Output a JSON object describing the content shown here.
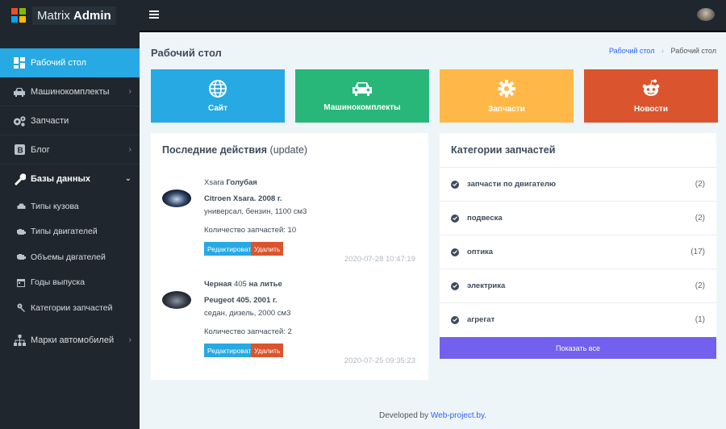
{
  "brand": {
    "name_light": "Matrix",
    "name_bold": "Admin"
  },
  "sidebar": {
    "items": [
      {
        "label": "Рабочий стол",
        "icon": "dashboard-icon",
        "active": true
      },
      {
        "label": "Машинокомплекты",
        "icon": "car-icon",
        "has_arrow": true
      },
      {
        "label": "Запчасти",
        "icon": "gears-icon"
      },
      {
        "label": "Блог",
        "icon": "blogger-icon",
        "has_arrow": true
      },
      {
        "label": "Базы данных",
        "icon": "wrench-icon",
        "has_arrow": true,
        "expanded": true
      }
    ],
    "subitems": [
      {
        "label": "Типы кузова",
        "icon": "car-small-icon"
      },
      {
        "label": "Типы двигателей",
        "icon": "engine-icon"
      },
      {
        "label": "Объемы двгателей",
        "icon": "engine-volume-icon"
      },
      {
        "label": "Годы выпуска",
        "icon": "calendar-icon"
      },
      {
        "label": "Категории запчастей",
        "icon": "key-icon"
      }
    ],
    "last_item": {
      "label": "Марки автомобилей",
      "icon": "sitemap-icon",
      "has_arrow": true
    }
  },
  "page": {
    "title": "Рабочий стол"
  },
  "breadcrumb": {
    "home": "Рабочий стол",
    "current": "Рабочий стол"
  },
  "tiles": [
    {
      "label": "Сайт",
      "icon": "globe-icon",
      "color": "#27a9e3"
    },
    {
      "label": "Машинокомплекты",
      "icon": "car-icon",
      "color": "#28b779"
    },
    {
      "label": "Запчасти",
      "icon": "gear-icon",
      "color": "#ffb848"
    },
    {
      "label": "Новости",
      "icon": "reddit-icon",
      "color": "#da542e"
    }
  ],
  "activity": {
    "title": "Последние действия",
    "title_suffix": "(update)",
    "items": [
      {
        "name_plain": "Xsara",
        "name_bold": "Голубая",
        "model": "Citroen Xsara. 2008 г.",
        "specs": "универсал, бензин, 1100 см3",
        "parts_count": "Количество запчастей: 10",
        "edit_label": "Редактировать",
        "delete_label": "Удалить",
        "time": "2020-07-28 10:47:19"
      },
      {
        "name_bold_prefix": "Черная",
        "name_plain": "405",
        "name_bold": "на литье",
        "model": "Peugeot 405. 2001 г.",
        "specs": "седан, дизель, 2000 см3",
        "parts_count": "Количество запчастей: 2",
        "edit_label": "Редактировать",
        "delete_label": "Удалить",
        "time": "2020-07-25 09:35:23"
      }
    ]
  },
  "categories": {
    "title": "Категории запчастей",
    "items": [
      {
        "name": "запчасти по двигателю",
        "count": "(2)"
      },
      {
        "name": "подвеска",
        "count": "(2)"
      },
      {
        "name": "оптика",
        "count": "(17)"
      },
      {
        "name": "электрика",
        "count": "(2)"
      },
      {
        "name": "агрегат",
        "count": "(1)"
      }
    ],
    "show_all": "Показать все"
  },
  "footer": {
    "text": "Developed by",
    "link": "Web-project.by."
  }
}
